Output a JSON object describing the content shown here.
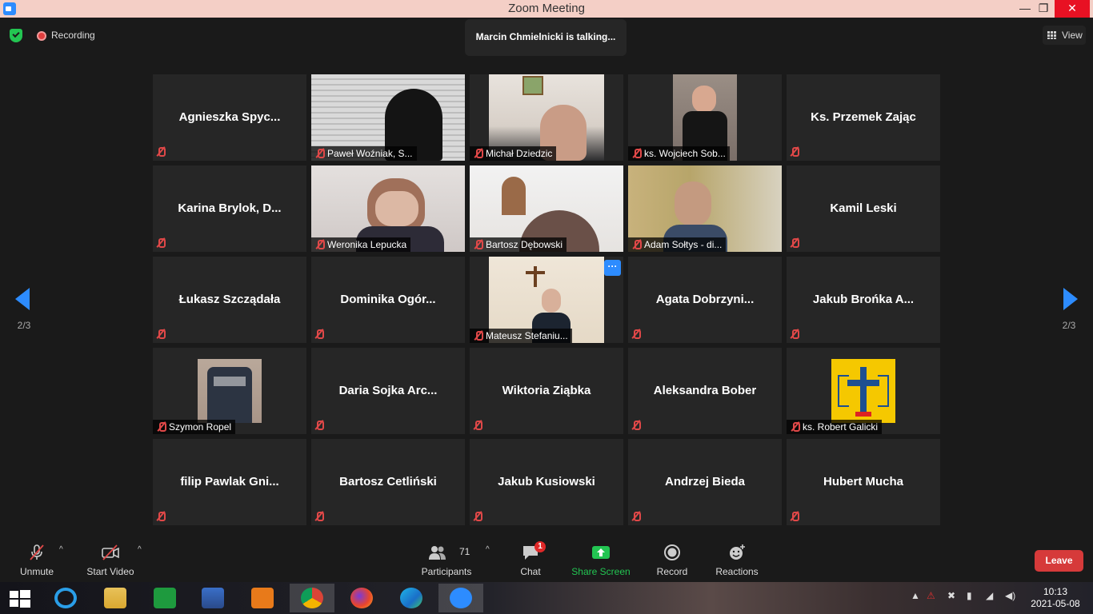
{
  "window": {
    "title": "Zoom Meeting",
    "minimize": "—",
    "restore": "❐",
    "close": "✕"
  },
  "topbar": {
    "recording_label": "Recording",
    "talking_text": "Marcin Chmielnicki is talking...",
    "view_label": "View"
  },
  "pagination": {
    "left_page": "2/3",
    "right_page": "2/3"
  },
  "participants_grid": [
    {
      "name": "Agnieszka  Spyc...",
      "video": false
    },
    {
      "name": "Paweł Woźniak, S...",
      "video": true
    },
    {
      "name": "Michał Dziedzic",
      "video": true
    },
    {
      "name": "ks. Wojciech Sob...",
      "video": true
    },
    {
      "name": "Ks. Przemek Zając",
      "video": false
    },
    {
      "name": "Karina  Brylok,  D...",
      "video": false
    },
    {
      "name": "Weronika Lepucka",
      "video": true
    },
    {
      "name": "Bartosz Dębowski",
      "video": true
    },
    {
      "name": "Adam Sołtys - di...",
      "video": true
    },
    {
      "name": "Kamil Leski",
      "video": false
    },
    {
      "name": "Łukasz Szcządała",
      "video": false
    },
    {
      "name": "Dominika  Ogór...",
      "video": false
    },
    {
      "name": "Mateusz Stefaniu...",
      "video": true
    },
    {
      "name": "Agata  Dobrzyni...",
      "video": false
    },
    {
      "name": "Jakub Brońka A...",
      "video": false
    },
    {
      "name": "Szymon Ropel",
      "video": true
    },
    {
      "name": "Daria  Sojka  Arc...",
      "video": false
    },
    {
      "name": "Wiktoria Ziąbka",
      "video": false
    },
    {
      "name": "Aleksandra Bober",
      "video": false
    },
    {
      "name": "ks. Robert Galicki",
      "video": true
    },
    {
      "name": "filip  Pawlak  Gni...",
      "video": false
    },
    {
      "name": "Bartosz Cetliński",
      "video": false
    },
    {
      "name": "Jakub Kusiowski",
      "video": false
    },
    {
      "name": "Andrzej Bieda",
      "video": false
    },
    {
      "name": "Hubert Mucha",
      "video": false
    }
  ],
  "more_button": "···",
  "toolbar": {
    "unmute": "Unmute",
    "start_video": "Start Video",
    "participants": "Participants",
    "participants_count": "71",
    "chat": "Chat",
    "chat_badge": "1",
    "share_screen": "Share Screen",
    "record": "Record",
    "reactions": "Reactions",
    "leave": "Leave",
    "caret": "^"
  },
  "taskbar": {
    "time": "10:13",
    "date": "2021-05-08"
  },
  "colors": {
    "accent": "#2d8cff",
    "share_green": "#23c552",
    "leave_red": "#d63a3a",
    "mute_red": "#e04848"
  }
}
